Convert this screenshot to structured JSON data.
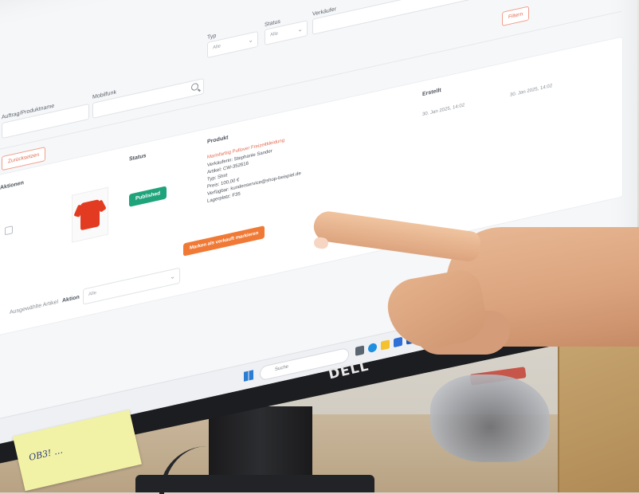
{
  "screen": {
    "filters": {
      "typ_label": "Typ",
      "status_label": "Status",
      "verkaeufer_label": "Verkäufer",
      "typ_value": "Alle",
      "status_value": "Alle",
      "mobile_label": "Mobilfunk",
      "id_label": "Auftrag/Produktname",
      "search_placeholder": "",
      "reset_label": "Zurücksetzen",
      "filter_label": "Filtern"
    },
    "table": {
      "headers": {
        "select": "Aktionen",
        "status": "Status",
        "product": "Produkt",
        "created": "Erstellt"
      },
      "row": {
        "status": "Published",
        "title": "Marinfarbig Pullover Freizeitkleidung",
        "line1": "Verkäuferin: Stephanie Sander",
        "line2": "Artikel: CW-352616",
        "line3": "Typ: Shirt",
        "line4": "Preis: 100,00 €",
        "line5": "Verfügbar: kundenservice@shop-beispiel.de",
        "line6": "Lagerplatz: F35",
        "action_button": "Marken als verkauft markieren",
        "date1": "30. Jan 2025, 14:02",
        "date2": "30. Jan 2025, 14:02"
      },
      "bulk": {
        "label": "Ausgewählte Artikel",
        "action_label": "Aktion",
        "action_value": "Alle"
      }
    },
    "taskbar": {
      "search_text": "Suche"
    }
  },
  "monitor": {
    "brand": "DELL"
  },
  "sticky_note": {
    "text": "OB3! …"
  }
}
